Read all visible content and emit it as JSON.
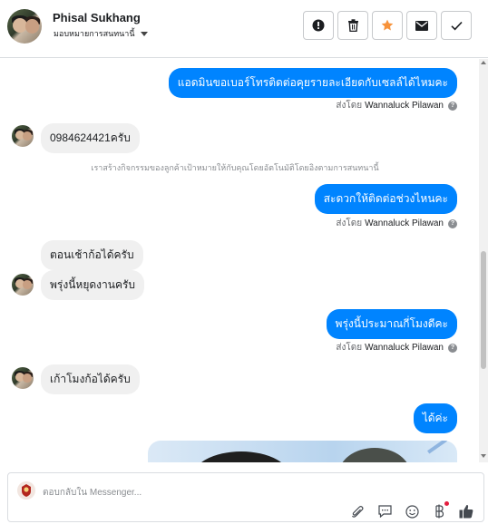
{
  "header": {
    "contact_name": "Phisal Sukhang",
    "assign_label": "มอบหมายการสนทนานี้",
    "buttons": [
      {
        "name": "mark-spam-button",
        "icon": "exclamation-icon"
      },
      {
        "name": "delete-button",
        "icon": "trash-icon"
      },
      {
        "name": "star-button",
        "icon": "star-icon",
        "color": "#f7923a"
      },
      {
        "name": "mark-unread-button",
        "icon": "envelope-icon"
      },
      {
        "name": "mark-done-button",
        "icon": "check-icon"
      }
    ]
  },
  "messages": {
    "m1": {
      "text": "แอดมินขอเบอร์โทรติดต่อคุยรายละเอียดกับเซลล์ได้ไหมคะ"
    },
    "m1_sent": {
      "prefix": "ส่งโดย",
      "agent": "Wannaluck Pilawan"
    },
    "m2": {
      "text": "0984624421ครับ"
    },
    "note": {
      "text": "เราสร้างกิจกรรมของลูกค้าเป้าหมายให้กับคุณโดยอัตโนมัติโดยอิงตามการสนทนานี้"
    },
    "m3": {
      "text": "สะดวกให้ติดต่อช่วงไหนคะ"
    },
    "m3_sent": {
      "prefix": "ส่งโดย",
      "agent": "Wannaluck Pilawan"
    },
    "m4": {
      "text": "ตอนเช้าก้อได้ครับ"
    },
    "m5": {
      "text": "พรุ่งนี้หยุดงานครับ"
    },
    "m6": {
      "text": "พรุ่งนี้ประมาณกี่โมงดีคะ"
    },
    "m6_sent": {
      "prefix": "ส่งโดย",
      "agent": "Wannaluck Pilawan"
    },
    "m7": {
      "text": "เก้าโมงก้อได้ครับ"
    },
    "m8": {
      "text": "ได้ค่ะ"
    }
  },
  "composer": {
    "placeholder": "ตอบกลับใน Messenger...",
    "tools": [
      "attachment-icon",
      "saved-reply-icon",
      "emoji-icon",
      "payment-icon",
      "like-icon"
    ]
  },
  "colors": {
    "outgoing_bubble": "#0084ff",
    "incoming_bubble": "#f0f0f0",
    "star_accent": "#f7923a"
  }
}
